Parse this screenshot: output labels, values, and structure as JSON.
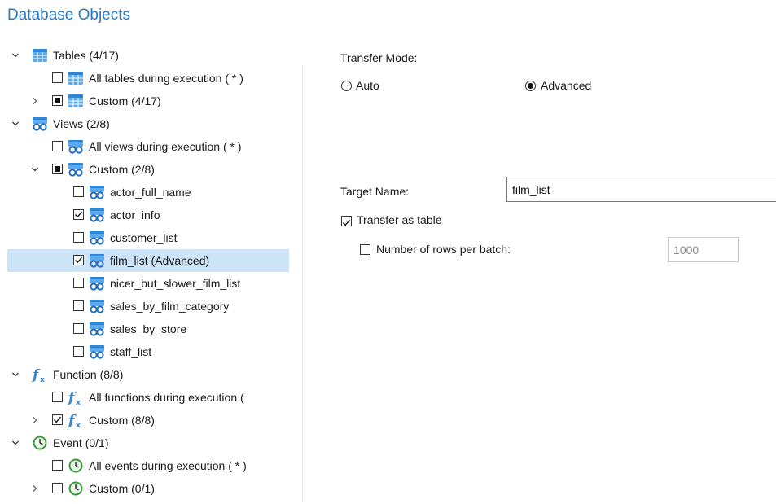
{
  "panel_title": "Database Objects",
  "tree": [
    {
      "level": 0,
      "expander": "down",
      "checkbox": null,
      "icon": "table-icon",
      "label": "Tables (4/17)",
      "name": "tree-node-tables"
    },
    {
      "level": 1,
      "expander": null,
      "checkbox": "unchecked",
      "icon": "table-icon",
      "label": "All tables during execution ( * )",
      "name": "tree-node-all-tables"
    },
    {
      "level": 1,
      "expander": "right",
      "checkbox": "partial",
      "icon": "table-icon",
      "label": "Custom (4/17)",
      "name": "tree-node-tables-custom"
    },
    {
      "level": 0,
      "expander": "down",
      "checkbox": null,
      "icon": "view-icon",
      "label": "Views (2/8)",
      "name": "tree-node-views"
    },
    {
      "level": 1,
      "expander": null,
      "checkbox": "unchecked",
      "icon": "view-icon",
      "label": "All views during execution ( * )",
      "name": "tree-node-all-views"
    },
    {
      "level": 1,
      "expander": "down",
      "checkbox": "partial",
      "icon": "view-icon",
      "label": "Custom (2/8)",
      "name": "tree-node-views-custom"
    },
    {
      "level": 2,
      "expander": null,
      "checkbox": "unchecked",
      "icon": "view-icon",
      "label": "actor_full_name",
      "name": "tree-node-actor-full-name"
    },
    {
      "level": 2,
      "expander": null,
      "checkbox": "checked",
      "icon": "view-icon",
      "label": "actor_info",
      "name": "tree-node-actor-info"
    },
    {
      "level": 2,
      "expander": null,
      "checkbox": "unchecked",
      "icon": "view-icon",
      "label": "customer_list",
      "name": "tree-node-customer-list"
    },
    {
      "level": 2,
      "expander": null,
      "checkbox": "checked",
      "icon": "view-icon",
      "label": "film_list (Advanced)",
      "name": "tree-node-film-list",
      "selected": true
    },
    {
      "level": 2,
      "expander": null,
      "checkbox": "unchecked",
      "icon": "view-icon",
      "label": "nicer_but_slower_film_list",
      "name": "tree-node-nicer-but-slower-film-list"
    },
    {
      "level": 2,
      "expander": null,
      "checkbox": "unchecked",
      "icon": "view-icon",
      "label": "sales_by_film_category",
      "name": "tree-node-sales-by-film-category"
    },
    {
      "level": 2,
      "expander": null,
      "checkbox": "unchecked",
      "icon": "view-icon",
      "label": "sales_by_store",
      "name": "tree-node-sales-by-store"
    },
    {
      "level": 2,
      "expander": null,
      "checkbox": "unchecked",
      "icon": "view-icon",
      "label": "staff_list",
      "name": "tree-node-staff-list"
    },
    {
      "level": 0,
      "expander": "down",
      "checkbox": null,
      "icon": "function-icon",
      "label": "Function (8/8)",
      "name": "tree-node-function"
    },
    {
      "level": 1,
      "expander": null,
      "checkbox": "unchecked",
      "icon": "function-icon",
      "label": "All functions during execution (",
      "name": "tree-node-all-functions"
    },
    {
      "level": 1,
      "expander": "right",
      "checkbox": "checked",
      "icon": "function-icon",
      "label": "Custom (8/8)",
      "name": "tree-node-function-custom"
    },
    {
      "level": 0,
      "expander": "down",
      "checkbox": null,
      "icon": "event-icon",
      "label": "Event (0/1)",
      "name": "tree-node-event"
    },
    {
      "level": 1,
      "expander": null,
      "checkbox": "unchecked",
      "icon": "event-icon",
      "label": "All events during execution ( * )",
      "name": "tree-node-all-events"
    },
    {
      "level": 1,
      "expander": "right",
      "checkbox": "unchecked",
      "icon": "event-icon",
      "label": "Custom (0/1)",
      "name": "tree-node-event-custom"
    }
  ],
  "transfer": {
    "mode_label": "Transfer Mode:",
    "auto_label": "Auto",
    "advanced_label": "Advanced",
    "selected_mode": "advanced",
    "target_name_label": "Target Name:",
    "target_name_value": "film_list",
    "as_table_label": "Transfer as table",
    "as_table_checked": true,
    "rows_per_batch_label": "Number of rows per batch:",
    "rows_per_batch_checked": false,
    "rows_per_batch_value": "1000"
  },
  "colors": {
    "title": "#2b78c2",
    "selection": "#cde3f7",
    "icon_blue": "#2f86d6",
    "event_green": "#3e9a3e"
  }
}
